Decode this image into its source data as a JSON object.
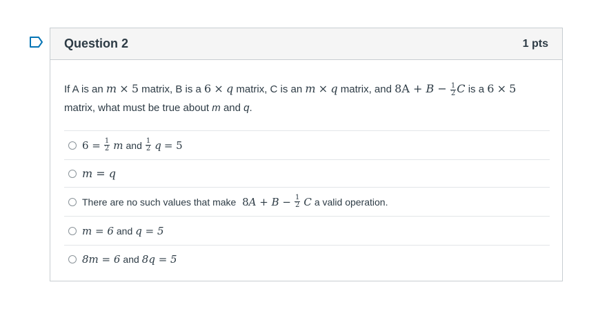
{
  "question": {
    "title": "Question 2",
    "points": "1 pts",
    "text": {
      "p1": "If A is an",
      "m": "m",
      "times": "×",
      "five": "5",
      "p2": "matrix, B is a",
      "six": "6",
      "q": "q",
      "p3": "matrix, C is an",
      "p4": "matrix, and",
      "expr_8A": "8A",
      "plus": "+",
      "B": "B",
      "minus": "−",
      "frac_num": "1",
      "frac_den": "2",
      "C": "C",
      "p5": "is a",
      "line2": "matrix, what must be true about",
      "and": "and",
      "end": "."
    }
  },
  "answers": [
    {
      "id": "a1",
      "parts": {
        "lhs": "6 =",
        "m": "m",
        "and": "and",
        "q": "q",
        "rhs": "= 5"
      }
    },
    {
      "id": "a2",
      "text": "m = q"
    },
    {
      "id": "a3",
      "prefix": "There are no such values that make",
      "suffix": "a valid operation."
    },
    {
      "id": "a4",
      "m": "m = 6",
      "and": "and",
      "q": "q = 5"
    },
    {
      "id": "a5",
      "m": "8m = 6",
      "and": "and",
      "q": "8q = 5"
    }
  ]
}
